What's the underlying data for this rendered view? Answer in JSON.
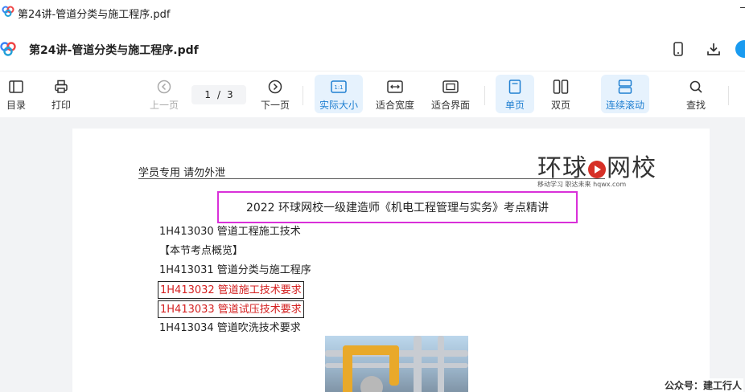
{
  "window": {
    "title": "第24讲-管道分类与施工程序.pdf"
  },
  "doc_header": {
    "title": "第24讲-管道分类与施工程序.pdf",
    "icons": [
      "mobile-icon",
      "download-icon"
    ]
  },
  "toolbar": {
    "toc_label": "目录",
    "print_label": "打印",
    "prev_label": "上一页",
    "page_current": "1",
    "page_separator": "/",
    "page_total": "3",
    "next_label": "下一页",
    "actual_size_label": "实际大小",
    "fit_width_label": "适合宽度",
    "fit_page_label": "适合界面",
    "single_page_label": "单页",
    "double_page_label": "双页",
    "continuous_label": "连续滚动",
    "search_label": "查找"
  },
  "page": {
    "watermark": "学员专用 请勿外泄",
    "brand_left": "环球",
    "brand_right": "网校",
    "brand_sub": "移动学习 职达未来 hqwx.com",
    "heading": "2022 环球网校一级建造师《机电工程管理与实务》考点精讲",
    "toc": [
      {
        "text": "1H413030  管道工程施工技术",
        "highlight": false
      },
      {
        "text": "【本节考点概览】",
        "highlight": false
      },
      {
        "text": "1H413031  管道分类与施工程序",
        "highlight": false
      },
      {
        "text": "1H413032  管道施工技术要求",
        "highlight": true
      },
      {
        "text": "1H413033  管道试压技术要求",
        "highlight": true
      },
      {
        "text": "1H413034  管道吹洗技术要求",
        "highlight": false
      }
    ]
  },
  "footer_note": "公众号：建工行人",
  "colors": {
    "accent": "#1f7fd1",
    "active_bg": "#e6f2fd",
    "heading_border": "#d930d9",
    "highlight_text": "#d42020",
    "brand_red": "#d63027"
  }
}
